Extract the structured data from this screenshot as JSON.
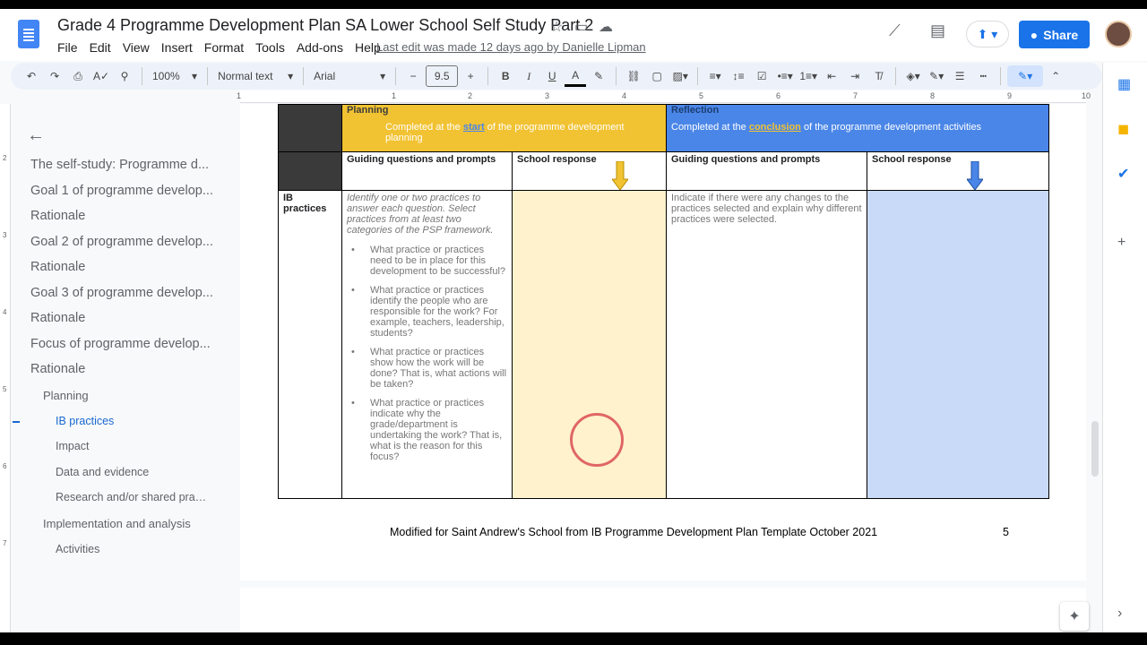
{
  "document": {
    "title": "Grade 4 Programme Development Plan SA Lower School Self Study Part 2",
    "last_edit": "Last edit was made 12 days ago by Danielle Lipman"
  },
  "menu": [
    "File",
    "Edit",
    "View",
    "Insert",
    "Format",
    "Tools",
    "Add-ons",
    "Help"
  ],
  "header_buttons": {
    "share": "Share"
  },
  "toolbar": {
    "zoom": "100%",
    "style": "Normal text",
    "font": "Arial",
    "font_size": "9.5"
  },
  "ruler_marks": [
    "1",
    "1",
    "2",
    "3",
    "4",
    "5",
    "6",
    "7",
    "8",
    "9",
    "10"
  ],
  "vruler_marks": [
    "2",
    "3",
    "4",
    "5",
    "6",
    "7"
  ],
  "outline": {
    "items": [
      {
        "label": "The self-study: Programme d...",
        "level": 1
      },
      {
        "label": "Goal 1 of programme develop...",
        "level": 1
      },
      {
        "label": "Rationale",
        "level": 1
      },
      {
        "label": "Goal 2 of programme develop...",
        "level": 1
      },
      {
        "label": "Rationale",
        "level": 1
      },
      {
        "label": "Goal 3 of programme develop...",
        "level": 1
      },
      {
        "label": "Rationale",
        "level": 1
      },
      {
        "label": "Focus of programme develop...",
        "level": 1
      },
      {
        "label": "Rationale",
        "level": 1
      },
      {
        "label": "Planning",
        "level": 2
      },
      {
        "label": "IB practices",
        "level": 3,
        "active": true
      },
      {
        "label": "Impact",
        "level": 3
      },
      {
        "label": "Data and evidence",
        "level": 3
      },
      {
        "label": "Research and/or shared prac...",
        "level": 3
      },
      {
        "label": "Implementation and analysis",
        "level": 2
      },
      {
        "label": "Activities",
        "level": 3
      }
    ]
  },
  "table": {
    "planning_title": "Planning",
    "planning_sub_pre": "Completed at the ",
    "planning_sub_link": "start",
    "planning_sub_post": " of the programme development planning",
    "reflection_title": "Reflection",
    "reflection_sub_pre": "Completed at the ",
    "reflection_sub_link": "conclusion",
    "reflection_sub_post": " of the programme development activities",
    "col_guiding_1": "Guiding questions and prompts",
    "col_response_1": "School response",
    "col_guiding_2": "Guiding questions and prompts",
    "col_response_2": "School response",
    "row_label": "IB practices",
    "instruction": "Identify one or two practices to answer each question. Select practices from at least two categories of the PSP framework.",
    "questions": [
      "What practice or practices need to be in place for this development to be successful?",
      "What practice or practices identify the people who are responsible for the work? For example, teachers, leadership, students?",
      "What practice or practices show how the work will be done? That is, what actions will be taken?",
      "What practice or practices indicate why the grade/department is undertaking the work? That is, what is the reason for this focus?"
    ],
    "reflection_prompt": "Indicate if there were any changes to the practices selected and explain why different practices were selected."
  },
  "footer": {
    "text": "Modified for Saint Andrew's School from IB Programme Development Plan Template October 2021",
    "page_number": "5"
  },
  "colors": {
    "planning": "#f1c232",
    "planning_light": "#fff2cc",
    "reflection": "#4a86e8",
    "reflection_light": "#c9daf8",
    "accent": "#1a73e8"
  }
}
